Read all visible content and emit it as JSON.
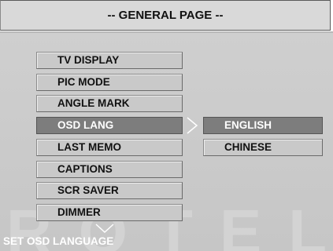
{
  "header": {
    "title": "-- GENERAL PAGE --"
  },
  "menu": {
    "items": [
      {
        "label": "TV DISPLAY"
      },
      {
        "label": "PIC MODE"
      },
      {
        "label": "ANGLE MARK"
      },
      {
        "label": "OSD LANG",
        "selected": true
      },
      {
        "label": "LAST MEMO"
      },
      {
        "label": "CAPTIONS"
      },
      {
        "label": "SCR SAVER"
      },
      {
        "label": "DIMMER"
      }
    ]
  },
  "submenu": {
    "items": [
      {
        "label": "ENGLISH",
        "selected": true
      },
      {
        "label": "CHINESE"
      }
    ]
  },
  "watermark": "ROTEL",
  "status": {
    "text": "SET OSD LANGUAGE"
  },
  "icons": {
    "submenu_arrow": "chevron-right-icon",
    "scroll_arrow": "chevron-down-icon"
  },
  "colors": {
    "selected": "#7d7d7d",
    "panel": "#c9c9c9",
    "header": "#d9d9d9"
  }
}
